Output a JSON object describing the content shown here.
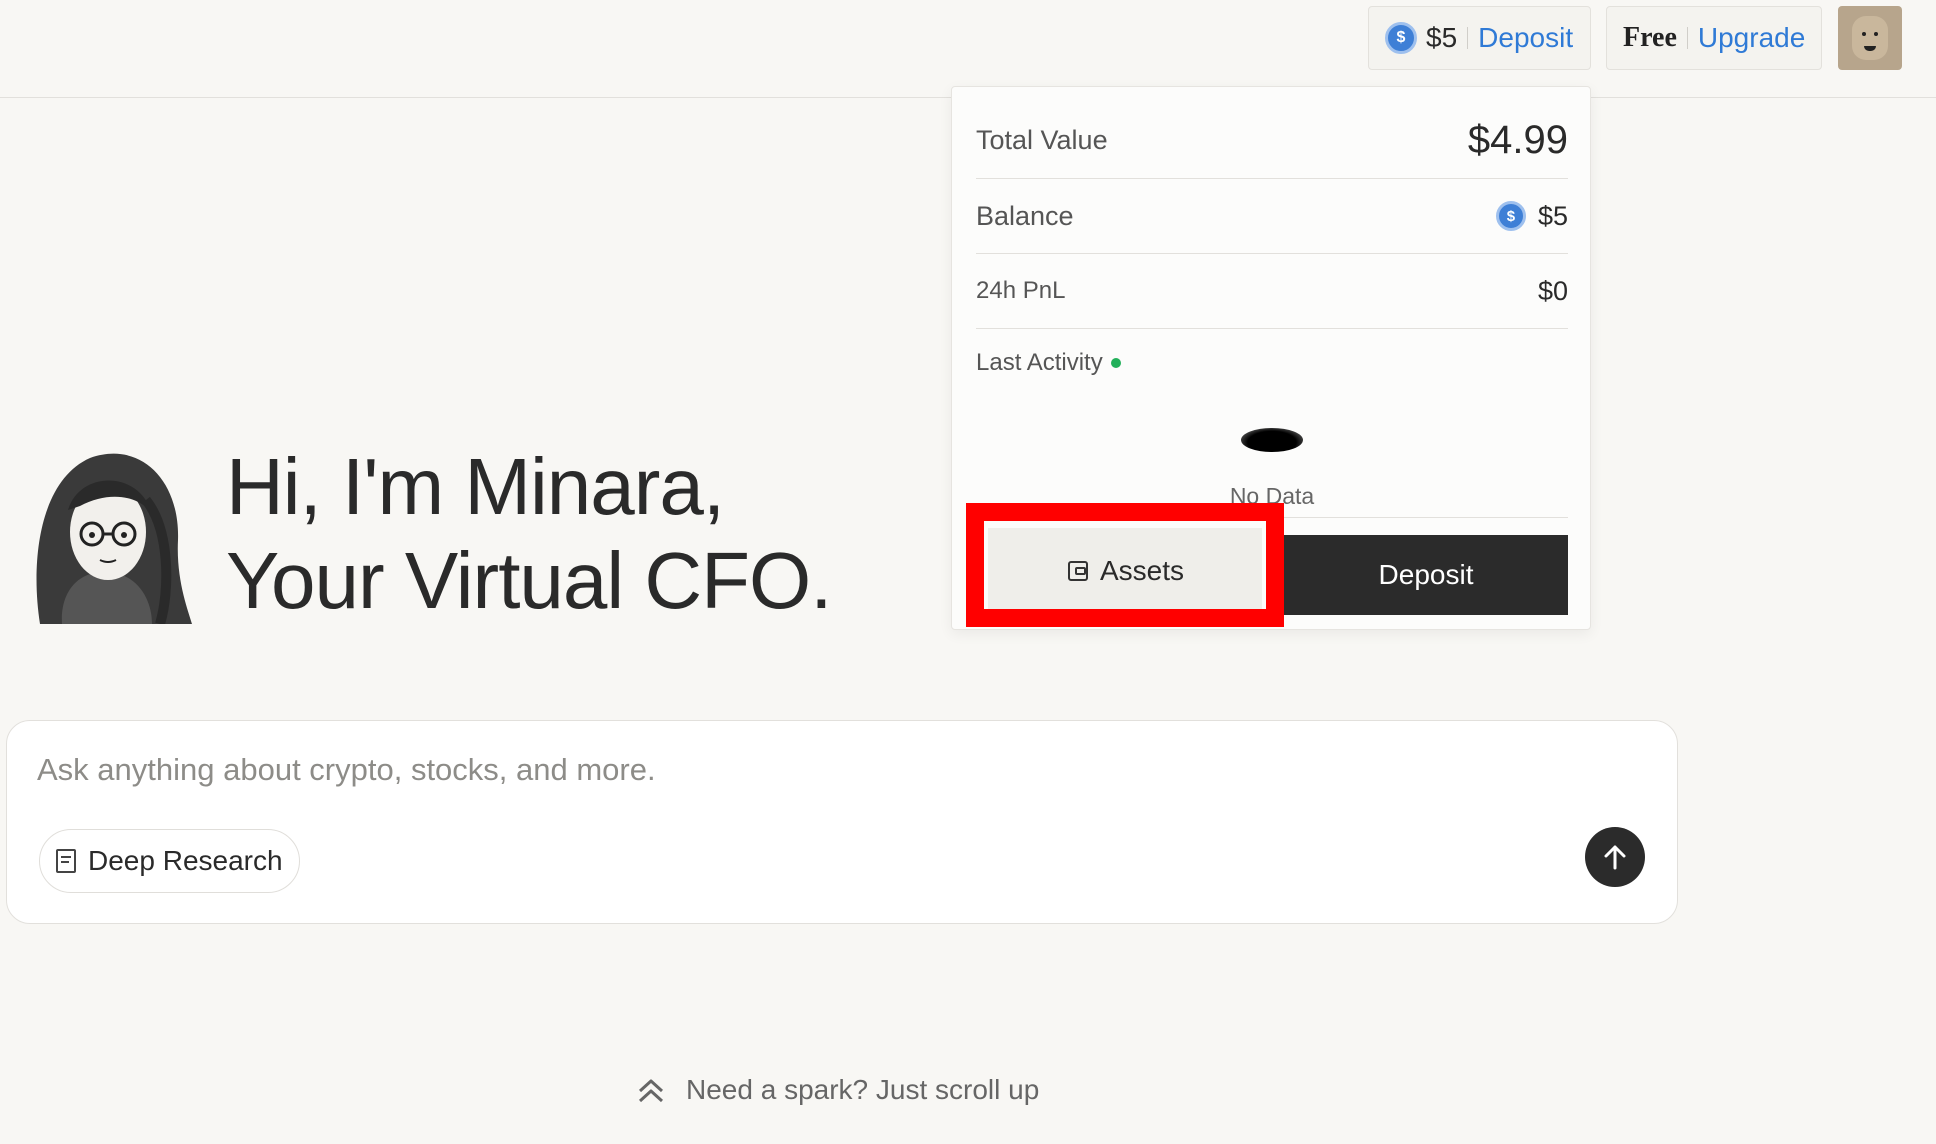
{
  "header": {
    "balance_amount": "$5",
    "deposit_link": "Deposit",
    "plan_label": "Free",
    "upgrade_link": "Upgrade"
  },
  "wallet_dropdown": {
    "total_value_label": "Total Value",
    "total_value": "$4.99",
    "balance_label": "Balance",
    "balance_value": "$5",
    "pnl_label": "24h PnL",
    "pnl_value": "$0",
    "last_activity_label": "Last Activity",
    "no_data": "No Data",
    "assets_button": "Assets",
    "deposit_button": "Deposit",
    "status_color": "#22b05a",
    "highlight_color": "#ff0000"
  },
  "hero": {
    "line1": "Hi, I'm Minara,",
    "line2": "Your Virtual CFO."
  },
  "chat": {
    "placeholder": "Ask anything about crypto, stocks, and more.",
    "deep_research_label": "Deep Research"
  },
  "footer": {
    "scroll_hint": "Need a spark? Just scroll up"
  }
}
